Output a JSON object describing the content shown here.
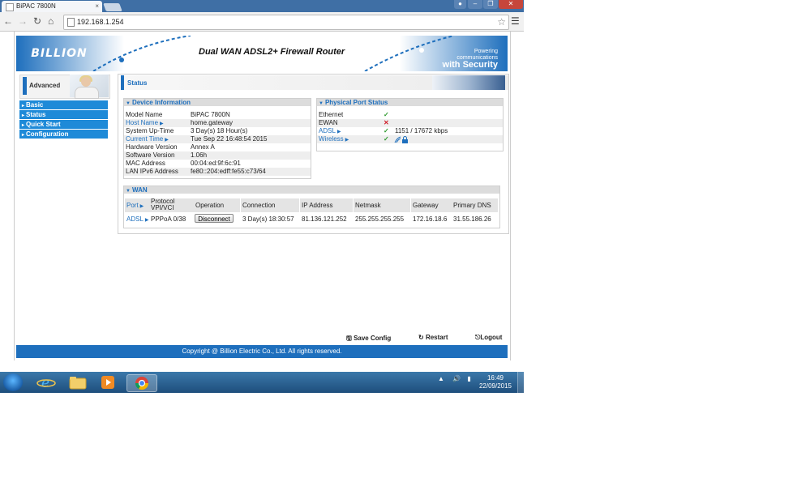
{
  "browser": {
    "tab_title": "BiPAC 7800N",
    "tab_close": "×",
    "url": "192.168.1.254"
  },
  "banner": {
    "logo": "BILLION",
    "title": "Dual WAN ADSL2+ Firewall Router",
    "powering_line1": "Powering communications",
    "powering_line2": "with Security"
  },
  "sidebar": {
    "mode": "Advanced",
    "items": [
      {
        "label": "Basic"
      },
      {
        "label": "Status"
      },
      {
        "label": "Quick Start"
      },
      {
        "label": "Configuration"
      }
    ]
  },
  "main": {
    "title": "Status",
    "device_info": {
      "heading": "Device Information",
      "rows": [
        {
          "label": "Model Name",
          "value": "BiPAC 7800N"
        },
        {
          "label": "Host Name",
          "value": "home.gateway"
        },
        {
          "label": "System Up-Time",
          "value": "3 Day(s) 18 Hour(s)"
        },
        {
          "label": "Current Time",
          "value": "Tue Sep 22 16:48:54 2015"
        },
        {
          "label": "Hardware Version",
          "value": "Annex A"
        },
        {
          "label": "Software Version",
          "value": "1.06h"
        },
        {
          "label": "MAC Address",
          "value": "00:04:ed:9f:6c:91"
        },
        {
          "label": "LAN IPv6 Address",
          "value": "fe80::204:edff:fe55:c73/64"
        }
      ]
    },
    "port_status": {
      "heading": "Physical Port Status",
      "rows": [
        {
          "label": "Ethernet",
          "status": "up",
          "detail": ""
        },
        {
          "label": "EWAN",
          "status": "down",
          "detail": ""
        },
        {
          "label": "ADSL",
          "status": "up",
          "detail": "1151 / 17672 kbps"
        },
        {
          "label": "Wireless",
          "status": "up",
          "detail": ""
        }
      ]
    },
    "wan": {
      "heading": "WAN",
      "headers": {
        "port": "Port",
        "protocol_line1": "Protocol",
        "protocol_line2": "VPI/VCI",
        "operation": "Operation",
        "connection": "Connection",
        "ip": "IP Address",
        "netmask": "Netmask",
        "gateway": "Gateway",
        "dns": "Primary DNS"
      },
      "row": {
        "port": "ADSL",
        "protocol": "PPPoA 0/38",
        "operation": "Disconnect",
        "connection": "3 Day(s) 18:30:57",
        "ip": "81.136.121.252",
        "netmask": "255.255.255.255",
        "gateway": "172.16.18.6",
        "dns": "31.55.186.26"
      }
    }
  },
  "footer": {
    "save_config": "Save Config",
    "restart": "Restart",
    "logout": "Logout",
    "copyright": "Copyright @ Billion Electric Co., Ltd. All rights reserved."
  },
  "taskbar": {
    "time": "16:49",
    "date": "22/09/2015"
  },
  "colors": {
    "brand_blue": "#1e6fbd",
    "menu_blue": "#1e8ad8",
    "ok_green": "#2e9a2e",
    "error_red": "#d0202a"
  }
}
